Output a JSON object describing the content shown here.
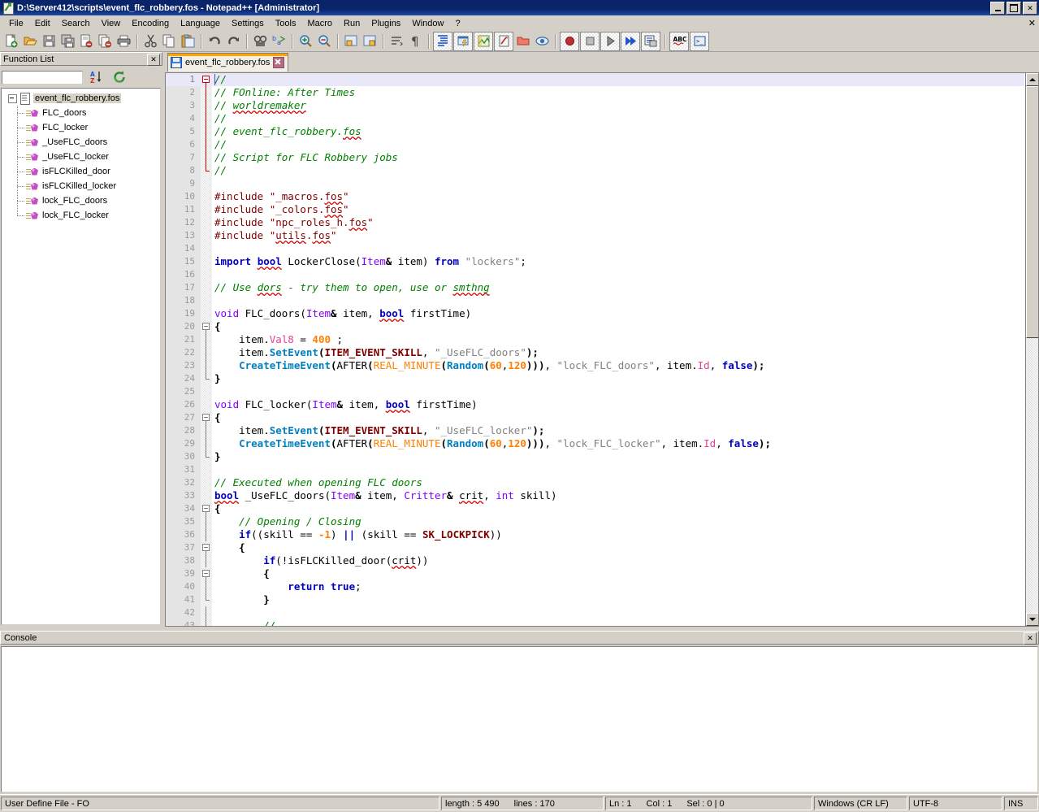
{
  "window": {
    "title": "D:\\Server412\\scripts\\event_flc_robbery.fos - Notepad++ [Administrator]",
    "icon": "notepad-plus-plus-icon",
    "buttons": {
      "minimize": "_",
      "maximize": "□",
      "close": "✕"
    }
  },
  "menubar": {
    "items": [
      "File",
      "Edit",
      "Search",
      "View",
      "Encoding",
      "Language",
      "Settings",
      "Tools",
      "Macro",
      "Run",
      "Plugins",
      "Window",
      "?"
    ],
    "close_label": "✕"
  },
  "toolbar": {
    "groups": [
      [
        "new-file-icon",
        "open-file-icon",
        "save-icon",
        "save-all-icon",
        "close-file-icon",
        "close-all-icon",
        "print-icon"
      ],
      [
        "cut-icon",
        "copy-icon",
        "paste-icon"
      ],
      [
        "undo-icon",
        "redo-icon"
      ],
      [
        "find-icon",
        "replace-icon"
      ],
      [
        "zoom-in-icon",
        "zoom-out-icon"
      ],
      [
        "sync-vertical-scroll-icon",
        "sync-horizontal-scroll-icon"
      ],
      [
        "word-wrap-icon",
        "show-all-chars-icon"
      ],
      [
        "indent-guide-icon",
        "user-defined-language-icon",
        "document-map-icon",
        "function-list-icon",
        "folder-as-workspace-icon",
        "monitoring-icon"
      ],
      [
        "record-macro-icon",
        "stop-recording-icon",
        "playback-macro-icon",
        "run-multiple-macro-icon",
        "save-macro-icon"
      ],
      [
        "spell-check-icon",
        "run-command-icon"
      ]
    ]
  },
  "function_list": {
    "caption": "Function List",
    "close_label": "✕",
    "search_value": "",
    "search_placeholder": "",
    "sort_button": "sort-az-icon",
    "reload_button": "reload-icon",
    "root": "event_flc_robbery.fos",
    "functions": [
      "FLC_doors",
      "FLC_locker",
      "_UseFLC_doors",
      "_UseFLC_locker",
      "isFLCKilled_door",
      "isFLCKilled_locker",
      "lock_FLC_doors",
      "lock_FLC_locker"
    ]
  },
  "tabs": [
    {
      "label": "event_flc_robbery.fos",
      "icon": "saved-document-icon",
      "close_label": "✕",
      "active": true
    }
  ],
  "editor": {
    "current_line": 1,
    "first_visible_line": 1,
    "lines": [
      {
        "n": 1,
        "fold": "open-red",
        "tokens": [
          {
            "t": "//",
            "c": "c-com"
          }
        ]
      },
      {
        "n": 2,
        "fold": "bar-red",
        "tokens": [
          {
            "t": "// FOnline: After Times",
            "c": "c-com"
          }
        ]
      },
      {
        "n": 3,
        "fold": "bar-red",
        "tokens": [
          {
            "t": "// ",
            "c": "c-com"
          },
          {
            "t": "worldremaker",
            "c": "c-com sq"
          }
        ]
      },
      {
        "n": 4,
        "fold": "bar-red",
        "tokens": [
          {
            "t": "//",
            "c": "c-com"
          }
        ]
      },
      {
        "n": 5,
        "fold": "bar-red",
        "tokens": [
          {
            "t": "// event_flc_robbery.",
            "c": "c-com"
          },
          {
            "t": "fos",
            "c": "c-com sq"
          }
        ]
      },
      {
        "n": 6,
        "fold": "bar-red",
        "tokens": [
          {
            "t": "//",
            "c": "c-com"
          }
        ]
      },
      {
        "n": 7,
        "fold": "bar-red",
        "tokens": [
          {
            "t": "// Script for FLC Robbery jobs",
            "c": "c-com"
          }
        ]
      },
      {
        "n": 8,
        "fold": "end-red",
        "tokens": [
          {
            "t": "//",
            "c": "c-com"
          }
        ]
      },
      {
        "n": 9,
        "fold": "none",
        "tokens": []
      },
      {
        "n": 10,
        "fold": "none",
        "tokens": [
          {
            "t": "#include \"_macros.",
            "c": "c-pre"
          },
          {
            "t": "fos",
            "c": "c-pre sq"
          },
          {
            "t": "\"",
            "c": "c-pre"
          }
        ]
      },
      {
        "n": 11,
        "fold": "none",
        "tokens": [
          {
            "t": "#include \"_colors.",
            "c": "c-pre"
          },
          {
            "t": "fos",
            "c": "c-pre sq"
          },
          {
            "t": "\"",
            "c": "c-pre"
          }
        ]
      },
      {
        "n": 12,
        "fold": "none",
        "tokens": [
          {
            "t": "#include \"npc_roles_h.",
            "c": "c-pre"
          },
          {
            "t": "fos",
            "c": "c-pre sq"
          },
          {
            "t": "\"",
            "c": "c-pre"
          }
        ]
      },
      {
        "n": 13,
        "fold": "none",
        "tokens": [
          {
            "t": "#include \"",
            "c": "c-pre"
          },
          {
            "t": "utils",
            "c": "c-pre sq"
          },
          {
            "t": ".",
            "c": "c-pre"
          },
          {
            "t": "fos",
            "c": "c-pre sq"
          },
          {
            "t": "\"",
            "c": "c-pre"
          }
        ]
      },
      {
        "n": 14,
        "fold": "none",
        "tokens": []
      },
      {
        "n": 15,
        "fold": "none",
        "tokens": [
          {
            "t": "import ",
            "c": "c-kw"
          },
          {
            "t": "bool",
            "c": "c-kw sq"
          },
          {
            "t": " LockerClose(",
            "c": "c-plain"
          },
          {
            "t": "Item",
            "c": "c-type"
          },
          {
            "t": "&",
            "c": "c-op"
          },
          {
            "t": " item) ",
            "c": "c-plain"
          },
          {
            "t": "from",
            "c": "c-kw"
          },
          {
            "t": " ",
            "c": "c-plain"
          },
          {
            "t": "\"lockers\"",
            "c": "c-str"
          },
          {
            "t": ";",
            "c": "c-plain"
          }
        ]
      },
      {
        "n": 16,
        "fold": "none",
        "tokens": []
      },
      {
        "n": 17,
        "fold": "none",
        "tokens": [
          {
            "t": "// Use ",
            "c": "c-com"
          },
          {
            "t": "dors",
            "c": "c-com sq"
          },
          {
            "t": " - try them to open, use or ",
            "c": "c-com"
          },
          {
            "t": "smthng",
            "c": "c-com sq"
          }
        ]
      },
      {
        "n": 18,
        "fold": "none",
        "tokens": []
      },
      {
        "n": 19,
        "fold": "none",
        "tokens": [
          {
            "t": "void",
            "c": "c-type"
          },
          {
            "t": " FLC_doors(",
            "c": "c-plain"
          },
          {
            "t": "Item",
            "c": "c-type"
          },
          {
            "t": "&",
            "c": "c-op"
          },
          {
            "t": " item, ",
            "c": "c-plain"
          },
          {
            "t": "bool",
            "c": "c-kw sq"
          },
          {
            "t": " firstTime)",
            "c": "c-plain"
          }
        ]
      },
      {
        "n": 20,
        "fold": "open-gray",
        "tokens": [
          {
            "t": "{",
            "c": "c-op"
          }
        ]
      },
      {
        "n": 21,
        "fold": "bar-gray",
        "tokens": [
          {
            "t": "    item.",
            "c": "c-plain"
          },
          {
            "t": "Val8",
            "c": "c-prop"
          },
          {
            "t": " = ",
            "c": "c-plain"
          },
          {
            "t": "400",
            "c": "c-num"
          },
          {
            "t": " ;",
            "c": "c-plain"
          }
        ]
      },
      {
        "n": 22,
        "fold": "bar-gray",
        "tokens": [
          {
            "t": "    item.",
            "c": "c-plain"
          },
          {
            "t": "SetEvent",
            "c": "c-fn"
          },
          {
            "t": "(",
            "c": "c-op"
          },
          {
            "t": "ITEM_EVENT_SKILL",
            "c": "c-const"
          },
          {
            "t": ", ",
            "c": "c-plain"
          },
          {
            "t": "\"_UseFLC_doors\"",
            "c": "c-str"
          },
          {
            "t": ");",
            "c": "c-op"
          }
        ]
      },
      {
        "n": 23,
        "fold": "bar-gray",
        "tokens": [
          {
            "t": "    CreateTimeEvent",
            "c": "c-fn"
          },
          {
            "t": "(",
            "c": "c-op"
          },
          {
            "t": "AFTER",
            "c": "c-plain"
          },
          {
            "t": "(",
            "c": "c-op"
          },
          {
            "t": "REAL_MINUTE",
            "c": "c-mac"
          },
          {
            "t": "(",
            "c": "c-op"
          },
          {
            "t": "Random",
            "c": "c-fn"
          },
          {
            "t": "(",
            "c": "c-op"
          },
          {
            "t": "60",
            "c": "c-num"
          },
          {
            "t": ",",
            "c": "c-plain"
          },
          {
            "t": "120",
            "c": "c-num"
          },
          {
            "t": ")))",
            "c": "c-op"
          },
          {
            "t": ", ",
            "c": "c-plain"
          },
          {
            "t": "\"lock_FLC_doors\"",
            "c": "c-str"
          },
          {
            "t": ", item.",
            "c": "c-plain"
          },
          {
            "t": "Id",
            "c": "c-prop"
          },
          {
            "t": ", ",
            "c": "c-plain"
          },
          {
            "t": "false",
            "c": "c-kw"
          },
          {
            "t": ");",
            "c": "c-op"
          }
        ]
      },
      {
        "n": 24,
        "fold": "end-gray",
        "tokens": [
          {
            "t": "}",
            "c": "c-op"
          }
        ]
      },
      {
        "n": 25,
        "fold": "none",
        "tokens": []
      },
      {
        "n": 26,
        "fold": "none",
        "tokens": [
          {
            "t": "void",
            "c": "c-type"
          },
          {
            "t": " FLC_locker(",
            "c": "c-plain"
          },
          {
            "t": "Item",
            "c": "c-type"
          },
          {
            "t": "&",
            "c": "c-op"
          },
          {
            "t": " item, ",
            "c": "c-plain"
          },
          {
            "t": "bool",
            "c": "c-kw sq"
          },
          {
            "t": " firstTime)",
            "c": "c-plain"
          }
        ]
      },
      {
        "n": 27,
        "fold": "open-gray",
        "tokens": [
          {
            "t": "{",
            "c": "c-op"
          }
        ]
      },
      {
        "n": 28,
        "fold": "bar-gray",
        "tokens": [
          {
            "t": "    item.",
            "c": "c-plain"
          },
          {
            "t": "SetEvent",
            "c": "c-fn"
          },
          {
            "t": "(",
            "c": "c-op"
          },
          {
            "t": "ITEM_EVENT_SKILL",
            "c": "c-const"
          },
          {
            "t": ", ",
            "c": "c-plain"
          },
          {
            "t": "\"_UseFLC_locker\"",
            "c": "c-str"
          },
          {
            "t": ");",
            "c": "c-op"
          }
        ]
      },
      {
        "n": 29,
        "fold": "bar-gray",
        "tokens": [
          {
            "t": "    CreateTimeEvent",
            "c": "c-fn"
          },
          {
            "t": "(",
            "c": "c-op"
          },
          {
            "t": "AFTER",
            "c": "c-plain"
          },
          {
            "t": "(",
            "c": "c-op"
          },
          {
            "t": "REAL_MINUTE",
            "c": "c-mac"
          },
          {
            "t": "(",
            "c": "c-op"
          },
          {
            "t": "Random",
            "c": "c-fn"
          },
          {
            "t": "(",
            "c": "c-op"
          },
          {
            "t": "60",
            "c": "c-num"
          },
          {
            "t": ",",
            "c": "c-plain"
          },
          {
            "t": "120",
            "c": "c-num"
          },
          {
            "t": ")))",
            "c": "c-op"
          },
          {
            "t": ", ",
            "c": "c-plain"
          },
          {
            "t": "\"lock_FLC_locker\"",
            "c": "c-str"
          },
          {
            "t": ", item.",
            "c": "c-plain"
          },
          {
            "t": "Id",
            "c": "c-prop"
          },
          {
            "t": ", ",
            "c": "c-plain"
          },
          {
            "t": "false",
            "c": "c-kw"
          },
          {
            "t": ");",
            "c": "c-op"
          }
        ]
      },
      {
        "n": 30,
        "fold": "end-gray",
        "tokens": [
          {
            "t": "}",
            "c": "c-op"
          }
        ]
      },
      {
        "n": 31,
        "fold": "none",
        "tokens": []
      },
      {
        "n": 32,
        "fold": "none",
        "tokens": [
          {
            "t": "// Executed when opening FLC doors",
            "c": "c-com"
          }
        ]
      },
      {
        "n": 33,
        "fold": "none",
        "tokens": [
          {
            "t": "bool",
            "c": "c-kw sq"
          },
          {
            "t": " _UseFLC_doors(",
            "c": "c-plain"
          },
          {
            "t": "Item",
            "c": "c-type"
          },
          {
            "t": "&",
            "c": "c-op"
          },
          {
            "t": " item, ",
            "c": "c-plain"
          },
          {
            "t": "Critter",
            "c": "c-type"
          },
          {
            "t": "&",
            "c": "c-op"
          },
          {
            "t": " ",
            "c": "c-plain"
          },
          {
            "t": "crit",
            "c": "c-plain sq"
          },
          {
            "t": ", ",
            "c": "c-plain"
          },
          {
            "t": "int",
            "c": "c-type"
          },
          {
            "t": " skill)",
            "c": "c-plain"
          }
        ]
      },
      {
        "n": 34,
        "fold": "open-gray",
        "tokens": [
          {
            "t": "{",
            "c": "c-op"
          }
        ]
      },
      {
        "n": 35,
        "fold": "bar-gray",
        "tokens": [
          {
            "t": "    // Opening / Closing",
            "c": "c-com"
          }
        ]
      },
      {
        "n": 36,
        "fold": "bar-gray",
        "tokens": [
          {
            "t": "    if",
            "c": "c-kw"
          },
          {
            "t": "((skill == ",
            "c": "c-plain"
          },
          {
            "t": "-1",
            "c": "c-num"
          },
          {
            "t": ") ",
            "c": "c-plain"
          },
          {
            "t": "||",
            "c": "c-kw"
          },
          {
            "t": " (skill == ",
            "c": "c-plain"
          },
          {
            "t": "SK_LOCKPICK",
            "c": "c-const"
          },
          {
            "t": "))",
            "c": "c-plain"
          }
        ]
      },
      {
        "n": 37,
        "fold": "open-gray2",
        "tokens": [
          {
            "t": "    {",
            "c": "c-op"
          }
        ]
      },
      {
        "n": 38,
        "fold": "bar-gray2",
        "tokens": [
          {
            "t": "        if",
            "c": "c-kw"
          },
          {
            "t": "(!isFLCKilled_door(",
            "c": "c-plain"
          },
          {
            "t": "crit",
            "c": "c-plain sq"
          },
          {
            "t": "))",
            "c": "c-plain"
          }
        ]
      },
      {
        "n": 39,
        "fold": "open-gray3",
        "tokens": [
          {
            "t": "        {",
            "c": "c-op"
          }
        ]
      },
      {
        "n": 40,
        "fold": "bar-gray3",
        "tokens": [
          {
            "t": "            return true",
            "c": "c-kw"
          },
          {
            "t": ";",
            "c": "c-plain"
          }
        ]
      },
      {
        "n": 41,
        "fold": "end-gray3",
        "tokens": [
          {
            "t": "        }",
            "c": "c-op"
          }
        ]
      },
      {
        "n": 42,
        "fold": "bar-gray2",
        "tokens": []
      },
      {
        "n": 43,
        "fold": "bar-gray2",
        "tokens": [
          {
            "t": "        // ... ... ...",
            "c": "c-com"
          }
        ]
      }
    ],
    "vscroll": {
      "thumb_top": 0,
      "thumb_height": 310,
      "up_arrow": "▲",
      "down_arrow": "▼"
    }
  },
  "console": {
    "caption": "Console",
    "close_label": "✕",
    "content": ""
  },
  "statusbar": {
    "language": "User Define File - FO",
    "length_label": "length : 5 490",
    "lines_label": "lines : 170",
    "ln": "Ln : 1",
    "col": "Col : 1",
    "sel": "Sel : 0 | 0",
    "eol": "Windows (CR LF)",
    "encoding": "UTF-8",
    "insert_mode": "INS"
  },
  "colors": {
    "title_bar": "#0a246a",
    "chrome": "#d4d0c8",
    "tab_active_accent": "#ffa400",
    "comment": "#008000",
    "preprocessor": "#7f0000",
    "keyword": "#0000c0",
    "type": "#8000ff",
    "function": "#0080c0",
    "constant": "#800000",
    "number": "#ff8000",
    "string": "#808080",
    "property": "#e0409a",
    "current_line": "#e8e8f8"
  }
}
